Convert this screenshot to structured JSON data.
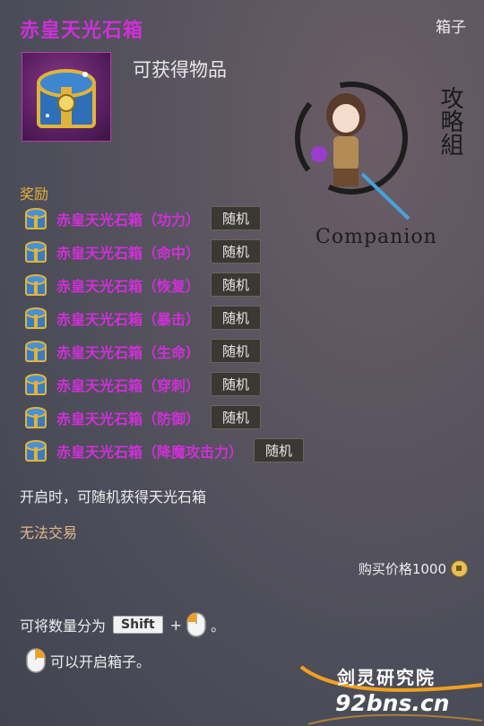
{
  "tooltip": {
    "title": "赤皇天光石箱",
    "category": "箱子",
    "subtitle": "可获得物品",
    "icon": "treasure-chest-icon",
    "watermark": {
      "brand": "Companion",
      "calligraphy": "攻略組"
    },
    "rewards_label": "奖励",
    "rewards": [
      {
        "name": "赤皇天光石箱（功力）",
        "badge": "随机"
      },
      {
        "name": "赤皇天光石箱（命中）",
        "badge": "随机"
      },
      {
        "name": "赤皇天光石箱（恢复）",
        "badge": "随机"
      },
      {
        "name": "赤皇天光石箱（暴击）",
        "badge": "随机"
      },
      {
        "name": "赤皇天光石箱（生命）",
        "badge": "随机"
      },
      {
        "name": "赤皇天光石箱（穿刺）",
        "badge": "随机"
      },
      {
        "name": "赤皇天光石箱（防御）",
        "badge": "随机"
      },
      {
        "name": "赤皇天光石箱（降魔攻击力）",
        "badge": "随机"
      }
    ],
    "description": "开启时，可随机获得天光石箱",
    "trade_status": "无法交易",
    "price": "购买价格1000",
    "hint_split_prefix": "可将数量分为",
    "hint_split_key": "Shift",
    "hint_split_plus": "+",
    "hint_split_suffix": "。",
    "hint_open": "可以开启箱子。"
  },
  "site": {
    "name": "剑灵研究院",
    "url": "92bns.cn"
  },
  "colors": {
    "title": "#d02fd8",
    "section": "#e6b035",
    "trade": "#e0b88f",
    "background": "#4a4c58"
  }
}
